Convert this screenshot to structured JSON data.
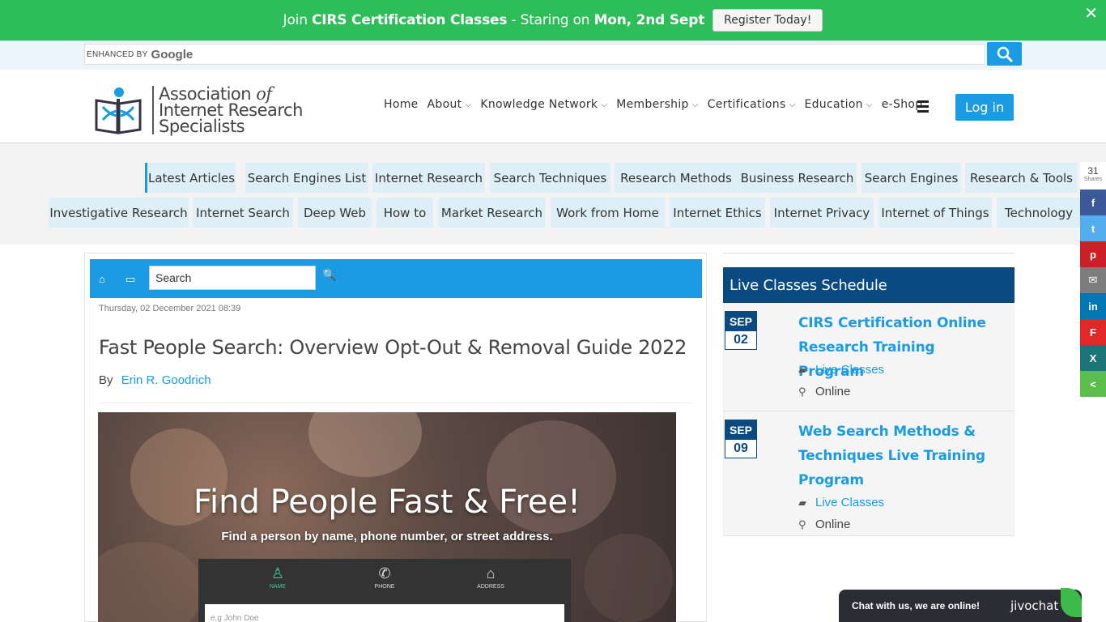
{
  "promo": {
    "prefix": "Join ",
    "bold1": "CIRS Certification Classes",
    "mid": " - Staring on ",
    "bold2": "Mon, 2nd Sept",
    "button": "Register Today!",
    "close": "✕"
  },
  "google": {
    "enhanced": "ENHANCED BY",
    "brand": "Google"
  },
  "logo": {
    "line1a": "Association ",
    "line1b": "of",
    "line2": "Internet Research",
    "line3": "Specialists"
  },
  "nav": {
    "items": [
      {
        "label": "Home",
        "dropdown": false
      },
      {
        "label": "About",
        "dropdown": true
      },
      {
        "label": "Knowledge Network",
        "dropdown": true
      },
      {
        "label": "Membership",
        "dropdown": true
      },
      {
        "label": "Certifications",
        "dropdown": true
      },
      {
        "label": "Education",
        "dropdown": true
      },
      {
        "label": "e-Shop",
        "dropdown": false
      }
    ],
    "login": "Log in"
  },
  "tags": {
    "row1": [
      "Latest Articles",
      "Search Engines List",
      "Internet Research",
      "Search Techniques",
      "Research Methods",
      "Business Research",
      "Search Engines",
      "Research & Tools"
    ],
    "row2": [
      "Investigative Research",
      "Internet Search",
      "Deep Web",
      "How to",
      "Market Research",
      "Work from Home",
      "Internet Ethics",
      "Internet Privacy",
      "Internet of Things",
      "Technology"
    ]
  },
  "share": {
    "count": "31",
    "label": "Shares",
    "networks": [
      {
        "name": "facebook",
        "glyph": "f",
        "color": "#3b5998"
      },
      {
        "name": "twitter",
        "glyph": "t",
        "color": "#55acee"
      },
      {
        "name": "pinterest",
        "glyph": "p",
        "color": "#cb2027"
      },
      {
        "name": "email",
        "glyph": "✉",
        "color": "#7d7d7d"
      },
      {
        "name": "linkedin",
        "glyph": "in",
        "color": "#0077b5"
      },
      {
        "name": "flipboard",
        "glyph": "F",
        "color": "#e12828"
      },
      {
        "name": "xing",
        "glyph": "X",
        "color": "#1a7576"
      },
      {
        "name": "sharethis",
        "glyph": "<",
        "color": "#5cbe4a"
      }
    ]
  },
  "article": {
    "search_value": "Search",
    "date": "Thursday, 02 December 2021 08:39",
    "title": "Fast People Search: Overview Opt-Out & Removal Guide 2022",
    "by": "By",
    "author": "Erin R. Goodrich",
    "hero": {
      "headline": "Find People Fast & Free!",
      "subline": "Find a person by name, phone number, or street address.",
      "tabs": [
        "NAME",
        "PHONE",
        "ADDRESS"
      ],
      "placeholder": "e.g John Doe"
    }
  },
  "sidebar": {
    "heading": "Live Classes Schedule",
    "events": [
      {
        "month": "SEP",
        "day": "02",
        "title": "CIRS Certification Online Research Training Program",
        "category": "Live Classes",
        "location": "Online"
      },
      {
        "month": "SEP",
        "day": "09",
        "title": "Web Search Methods & Techniques Live Training Program",
        "category": "Live Classes",
        "location": "Online"
      }
    ]
  },
  "chat": {
    "message": "Chat with us, we are online!",
    "brand": "jivochat"
  }
}
